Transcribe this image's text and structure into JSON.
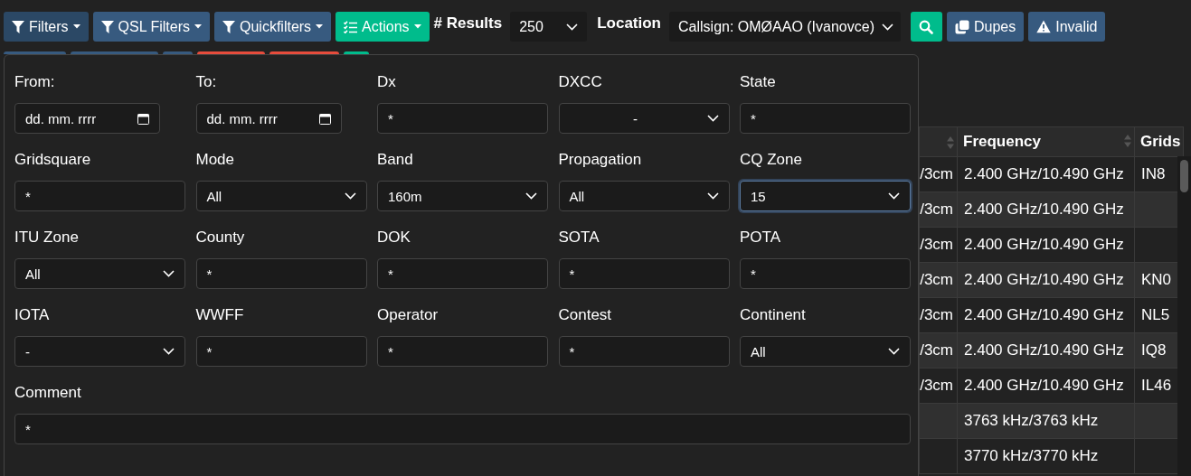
{
  "toolbar": {
    "buttons": [
      {
        "label": "Filters",
        "kind": "funnel",
        "expanded": true
      },
      {
        "label": "QSL Filters",
        "kind": "funnel",
        "expanded": false
      },
      {
        "label": "Quickfilters",
        "kind": "funnel",
        "expanded": false
      },
      {
        "label": "Actions",
        "kind": "checklist",
        "expanded": false
      }
    ],
    "results": {
      "label": "# Results",
      "value": "250"
    },
    "location": {
      "label": "Location",
      "value": "Callsign: OMØAAO (Ivanovce)"
    },
    "tools": [
      {
        "kind": "search"
      },
      {
        "kind": "copy",
        "label": "Dupes"
      },
      {
        "kind": "warning",
        "label": "Invalid"
      }
    ]
  },
  "second_row": [
    {
      "color": "#375a7f"
    },
    {
      "color": "#375a7f"
    },
    {
      "color": "#375a7f"
    },
    {
      "color": "#e74c3c"
    },
    {
      "color": "#e74c3c"
    },
    {
      "color": "#00bc8c"
    }
  ],
  "filters": [
    {
      "label": "From:",
      "kind": "date",
      "placeholder": "dd. mm. rrrr"
    },
    {
      "label": "To:",
      "kind": "date",
      "placeholder": "dd. mm. rrrr"
    },
    {
      "label": "Dx",
      "kind": "text",
      "value": "*"
    },
    {
      "label": "DXCC",
      "kind": "centered-select",
      "value": "-"
    },
    {
      "label": "State",
      "kind": "text",
      "value": "*"
    },
    {
      "label": "Gridsquare",
      "kind": "text",
      "value": "*"
    },
    {
      "label": "Mode",
      "kind": "select",
      "value": "All"
    },
    {
      "label": "Band",
      "kind": "select",
      "value": "160m"
    },
    {
      "label": "Propagation",
      "kind": "select",
      "value": "All"
    },
    {
      "label": "CQ Zone",
      "kind": "select",
      "value": "15",
      "focused": true
    },
    {
      "label": "ITU Zone",
      "kind": "select",
      "value": "All"
    },
    {
      "label": "County",
      "kind": "text",
      "value": "*"
    },
    {
      "label": "DOK",
      "kind": "text",
      "value": "*"
    },
    {
      "label": "SOTA",
      "kind": "text",
      "value": "*"
    },
    {
      "label": "POTA",
      "kind": "text",
      "value": "*"
    },
    {
      "label": "IOTA",
      "kind": "select",
      "value": "-"
    },
    {
      "label": "WWFF",
      "kind": "text",
      "value": "*"
    },
    {
      "label": "Operator",
      "kind": "text",
      "value": "*"
    },
    {
      "label": "Contest",
      "kind": "text",
      "value": "*"
    },
    {
      "label": "Continent",
      "kind": "select",
      "value": "All"
    },
    {
      "label": "Comment",
      "kind": "long-text",
      "value": "*"
    }
  ],
  "table": {
    "columns": [
      {},
      {
        "label": "Frequency"
      },
      {
        "label": "Grids"
      }
    ],
    "rows": [
      [
        "/3cm",
        "2.400 GHz/10.490 GHz",
        "IN8"
      ],
      [
        "/3cm",
        "2.400 GHz/10.490 GHz",
        ""
      ],
      [
        "/3cm",
        "2.400 GHz/10.490 GHz",
        ""
      ],
      [
        "/3cm",
        "2.400 GHz/10.490 GHz",
        "KN0"
      ],
      [
        "/3cm",
        "2.400 GHz/10.490 GHz",
        "NL5"
      ],
      [
        "/3cm",
        "2.400 GHz/10.490 GHz",
        "IQ8"
      ],
      [
        "/3cm",
        "2.400 GHz/10.490 GHz",
        "IL46"
      ],
      [
        "",
        "3763 kHz/3763 kHz",
        ""
      ],
      [
        "",
        "3770 kHz/3770 kHz",
        ""
      ]
    ]
  }
}
